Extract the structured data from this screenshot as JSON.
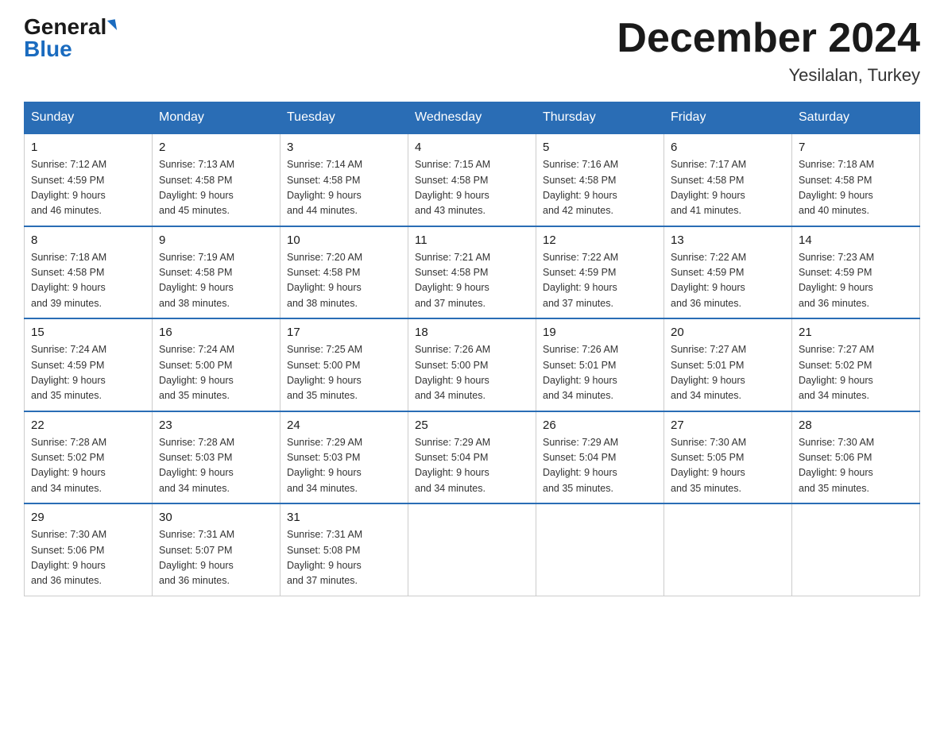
{
  "header": {
    "logo_general": "General",
    "logo_blue": "Blue",
    "month_title": "December 2024",
    "location": "Yesilalan, Turkey"
  },
  "weekdays": [
    "Sunday",
    "Monday",
    "Tuesday",
    "Wednesday",
    "Thursday",
    "Friday",
    "Saturday"
  ],
  "weeks": [
    [
      {
        "day": "1",
        "sunrise": "7:12 AM",
        "sunset": "4:59 PM",
        "daylight": "9 hours and 46 minutes."
      },
      {
        "day": "2",
        "sunrise": "7:13 AM",
        "sunset": "4:58 PM",
        "daylight": "9 hours and 45 minutes."
      },
      {
        "day": "3",
        "sunrise": "7:14 AM",
        "sunset": "4:58 PM",
        "daylight": "9 hours and 44 minutes."
      },
      {
        "day": "4",
        "sunrise": "7:15 AM",
        "sunset": "4:58 PM",
        "daylight": "9 hours and 43 minutes."
      },
      {
        "day": "5",
        "sunrise": "7:16 AM",
        "sunset": "4:58 PM",
        "daylight": "9 hours and 42 minutes."
      },
      {
        "day": "6",
        "sunrise": "7:17 AM",
        "sunset": "4:58 PM",
        "daylight": "9 hours and 41 minutes."
      },
      {
        "day": "7",
        "sunrise": "7:18 AM",
        "sunset": "4:58 PM",
        "daylight": "9 hours and 40 minutes."
      }
    ],
    [
      {
        "day": "8",
        "sunrise": "7:18 AM",
        "sunset": "4:58 PM",
        "daylight": "9 hours and 39 minutes."
      },
      {
        "day": "9",
        "sunrise": "7:19 AM",
        "sunset": "4:58 PM",
        "daylight": "9 hours and 38 minutes."
      },
      {
        "day": "10",
        "sunrise": "7:20 AM",
        "sunset": "4:58 PM",
        "daylight": "9 hours and 38 minutes."
      },
      {
        "day": "11",
        "sunrise": "7:21 AM",
        "sunset": "4:58 PM",
        "daylight": "9 hours and 37 minutes."
      },
      {
        "day": "12",
        "sunrise": "7:22 AM",
        "sunset": "4:59 PM",
        "daylight": "9 hours and 37 minutes."
      },
      {
        "day": "13",
        "sunrise": "7:22 AM",
        "sunset": "4:59 PM",
        "daylight": "9 hours and 36 minutes."
      },
      {
        "day": "14",
        "sunrise": "7:23 AM",
        "sunset": "4:59 PM",
        "daylight": "9 hours and 36 minutes."
      }
    ],
    [
      {
        "day": "15",
        "sunrise": "7:24 AM",
        "sunset": "4:59 PM",
        "daylight": "9 hours and 35 minutes."
      },
      {
        "day": "16",
        "sunrise": "7:24 AM",
        "sunset": "5:00 PM",
        "daylight": "9 hours and 35 minutes."
      },
      {
        "day": "17",
        "sunrise": "7:25 AM",
        "sunset": "5:00 PM",
        "daylight": "9 hours and 35 minutes."
      },
      {
        "day": "18",
        "sunrise": "7:26 AM",
        "sunset": "5:00 PM",
        "daylight": "9 hours and 34 minutes."
      },
      {
        "day": "19",
        "sunrise": "7:26 AM",
        "sunset": "5:01 PM",
        "daylight": "9 hours and 34 minutes."
      },
      {
        "day": "20",
        "sunrise": "7:27 AM",
        "sunset": "5:01 PM",
        "daylight": "9 hours and 34 minutes."
      },
      {
        "day": "21",
        "sunrise": "7:27 AM",
        "sunset": "5:02 PM",
        "daylight": "9 hours and 34 minutes."
      }
    ],
    [
      {
        "day": "22",
        "sunrise": "7:28 AM",
        "sunset": "5:02 PM",
        "daylight": "9 hours and 34 minutes."
      },
      {
        "day": "23",
        "sunrise": "7:28 AM",
        "sunset": "5:03 PM",
        "daylight": "9 hours and 34 minutes."
      },
      {
        "day": "24",
        "sunrise": "7:29 AM",
        "sunset": "5:03 PM",
        "daylight": "9 hours and 34 minutes."
      },
      {
        "day": "25",
        "sunrise": "7:29 AM",
        "sunset": "5:04 PM",
        "daylight": "9 hours and 34 minutes."
      },
      {
        "day": "26",
        "sunrise": "7:29 AM",
        "sunset": "5:04 PM",
        "daylight": "9 hours and 35 minutes."
      },
      {
        "day": "27",
        "sunrise": "7:30 AM",
        "sunset": "5:05 PM",
        "daylight": "9 hours and 35 minutes."
      },
      {
        "day": "28",
        "sunrise": "7:30 AM",
        "sunset": "5:06 PM",
        "daylight": "9 hours and 35 minutes."
      }
    ],
    [
      {
        "day": "29",
        "sunrise": "7:30 AM",
        "sunset": "5:06 PM",
        "daylight": "9 hours and 36 minutes."
      },
      {
        "day": "30",
        "sunrise": "7:31 AM",
        "sunset": "5:07 PM",
        "daylight": "9 hours and 36 minutes."
      },
      {
        "day": "31",
        "sunrise": "7:31 AM",
        "sunset": "5:08 PM",
        "daylight": "9 hours and 37 minutes."
      },
      null,
      null,
      null,
      null
    ]
  ],
  "labels": {
    "sunrise": "Sunrise:",
    "sunset": "Sunset:",
    "daylight": "Daylight:"
  }
}
